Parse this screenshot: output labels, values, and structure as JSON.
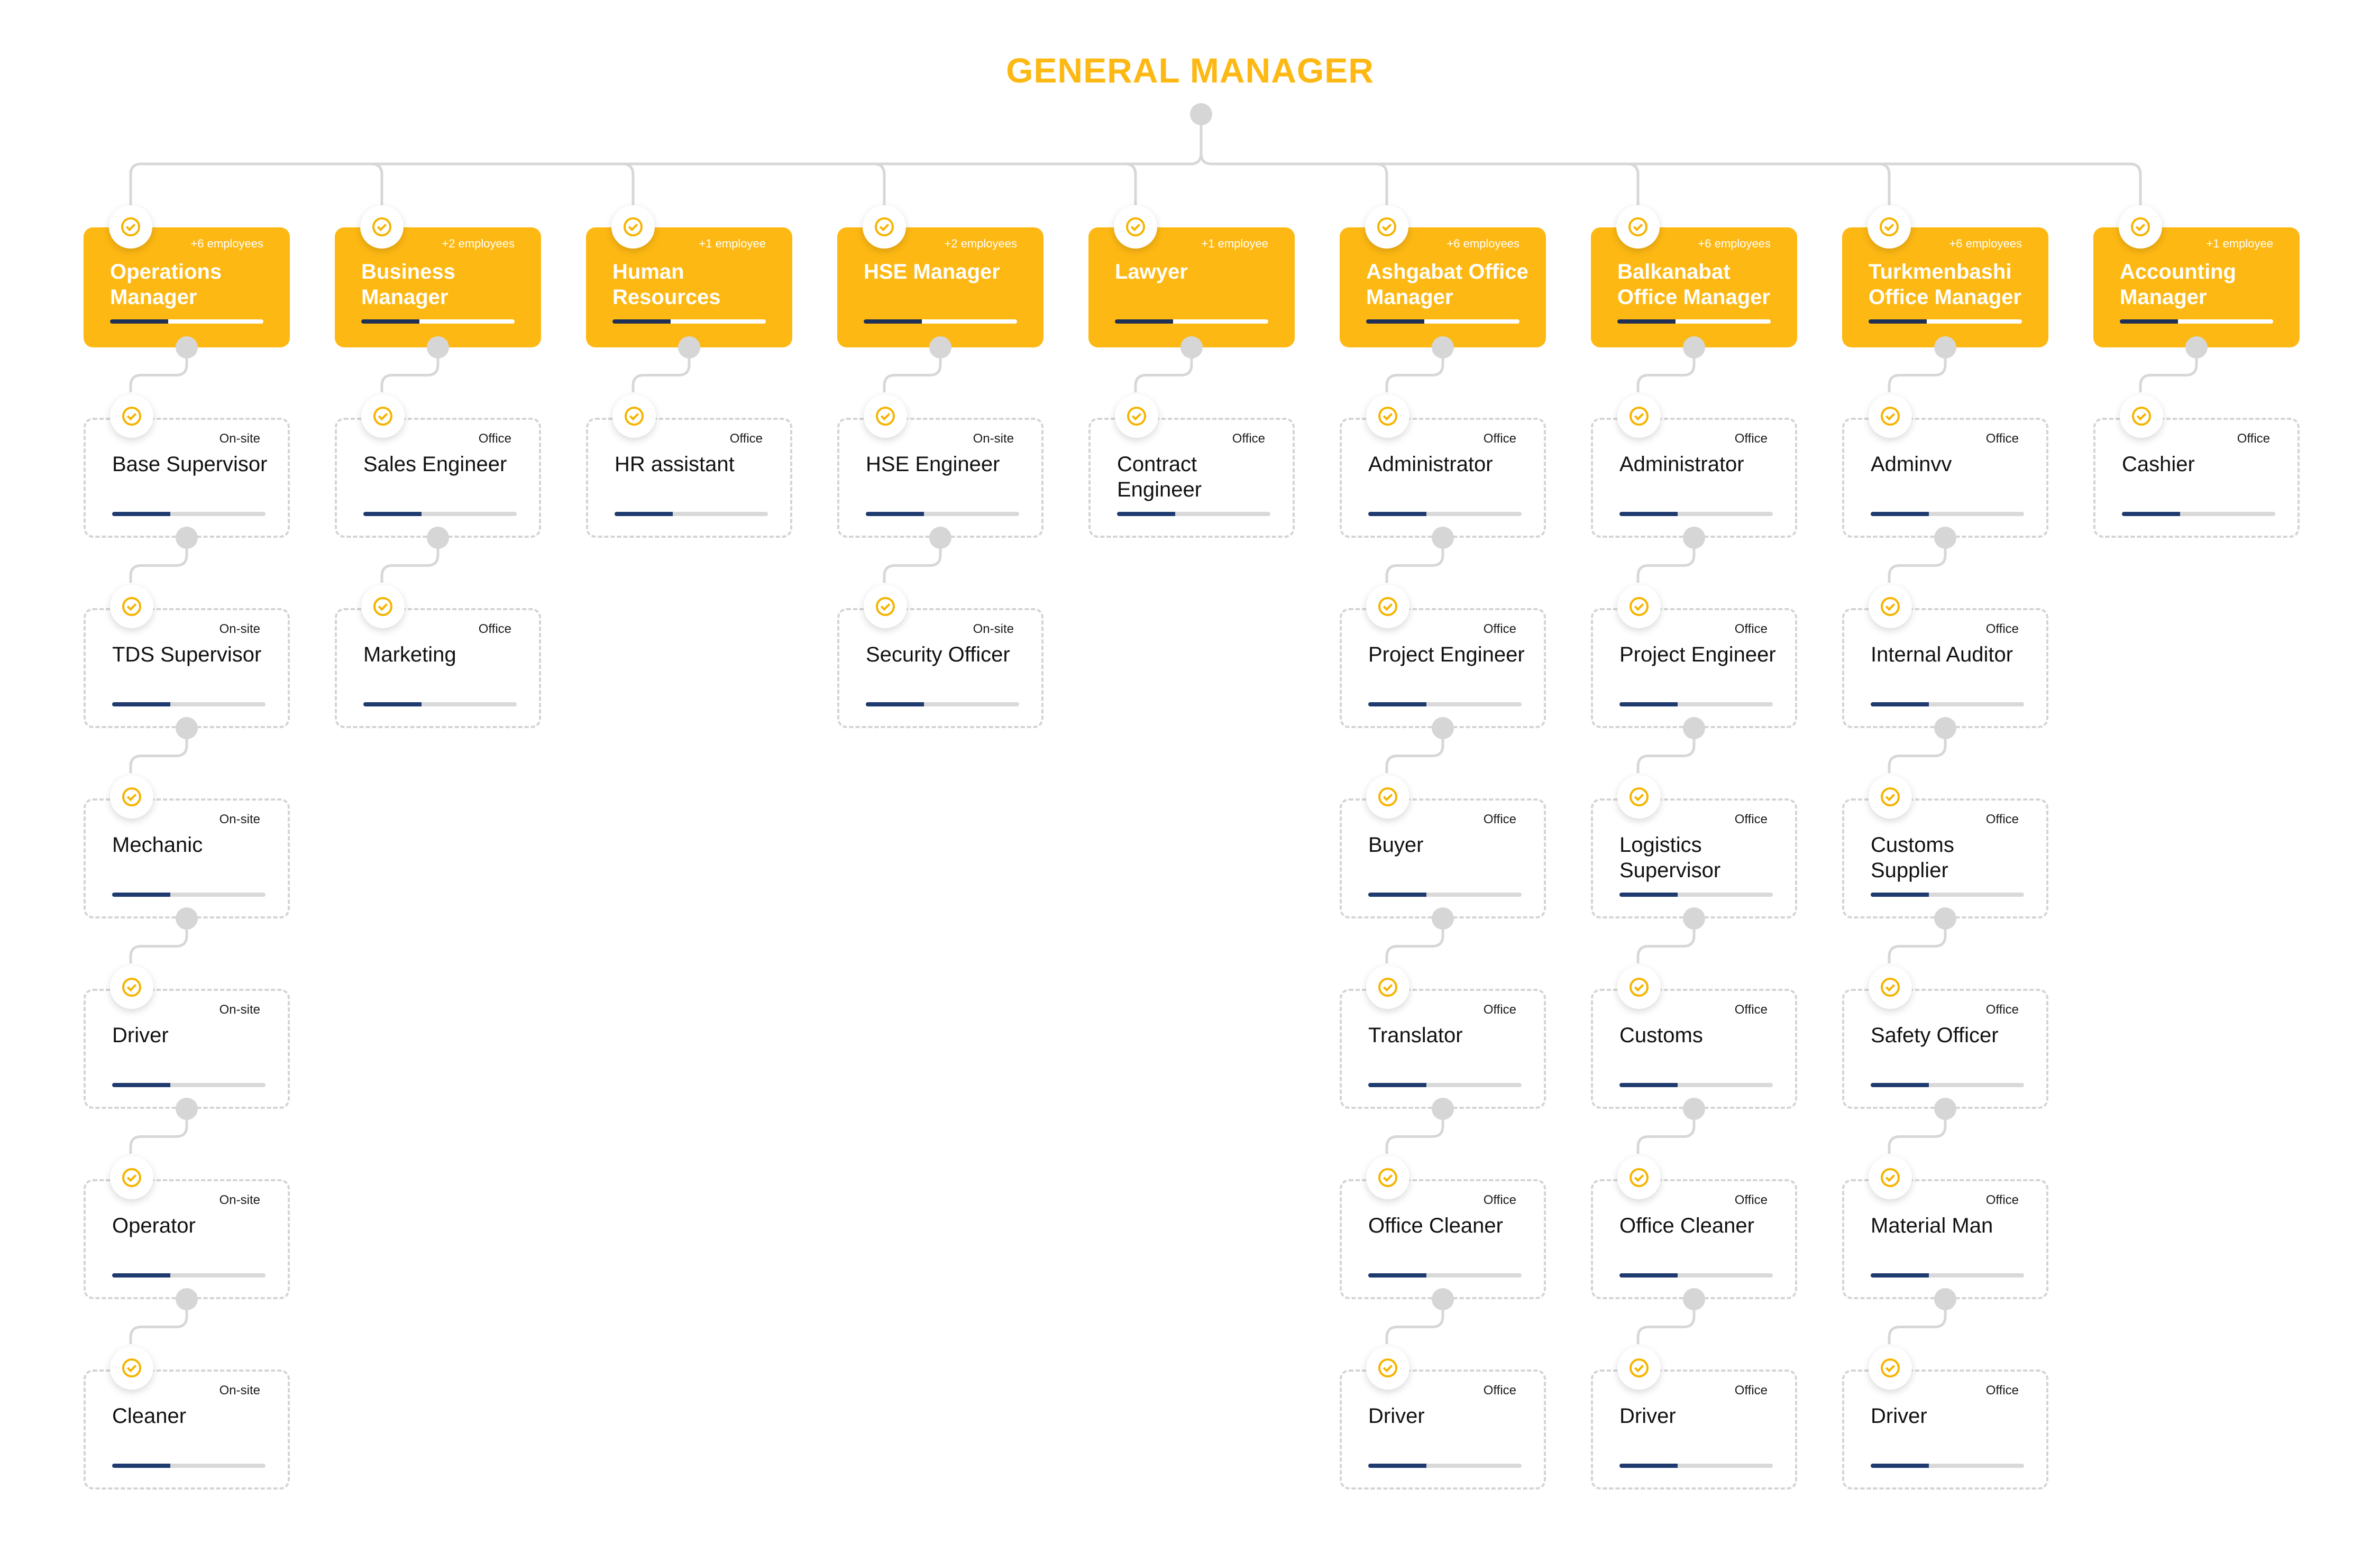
{
  "title": "GENERAL MANAGER",
  "columns": [
    {
      "manager": {
        "label": "Operations Manager",
        "count": "+6 employees",
        "progress": 0.38
      },
      "staff": [
        {
          "label": "Base Supervisor",
          "tag": "On-site",
          "progress": 0.38
        },
        {
          "label": "TDS Supervisor",
          "tag": "On-site",
          "progress": 0.38
        },
        {
          "label": "Mechanic",
          "tag": "On-site",
          "progress": 0.38
        },
        {
          "label": "Driver",
          "tag": "On-site",
          "progress": 0.38
        },
        {
          "label": "Operator",
          "tag": "On-site",
          "progress": 0.38
        },
        {
          "label": "Cleaner",
          "tag": "On-site",
          "progress": 0.38
        }
      ]
    },
    {
      "manager": {
        "label": "Business Manager",
        "count": "+2 employees",
        "progress": 0.38
      },
      "staff": [
        {
          "label": "Sales Engineer",
          "tag": "Office",
          "progress": 0.38
        },
        {
          "label": "Marketing",
          "tag": "Office",
          "progress": 0.38
        }
      ]
    },
    {
      "manager": {
        "label": "Human Resources",
        "count": "+1 employee",
        "progress": 0.38
      },
      "staff": [
        {
          "label": "HR assistant",
          "tag": "Office",
          "progress": 0.38
        }
      ]
    },
    {
      "manager": {
        "label": "HSE Manager",
        "count": "+2 employees",
        "progress": 0.38
      },
      "staff": [
        {
          "label": "HSE Engineer",
          "tag": "On-site",
          "progress": 0.38
        },
        {
          "label": "Security Officer",
          "tag": "On-site",
          "progress": 0.38
        }
      ]
    },
    {
      "manager": {
        "label": "Lawyer",
        "count": "+1 employee",
        "progress": 0.38
      },
      "staff": [
        {
          "label": "Contract Engineer",
          "tag": "Office",
          "progress": 0.38
        }
      ]
    },
    {
      "manager": {
        "label": "Ashgabat Office Manager",
        "count": "+6 employees",
        "progress": 0.38
      },
      "staff": [
        {
          "label": "Administrator",
          "tag": "Office",
          "progress": 0.38
        },
        {
          "label": "Project Engineer",
          "tag": "Office",
          "progress": 0.38
        },
        {
          "label": "Buyer",
          "tag": "Office",
          "progress": 0.38
        },
        {
          "label": "Translator",
          "tag": "Office",
          "progress": 0.38
        },
        {
          "label": "Office Cleaner",
          "tag": "Office",
          "progress": 0.38
        },
        {
          "label": "Driver",
          "tag": "Office",
          "progress": 0.38
        }
      ]
    },
    {
      "manager": {
        "label": "Balkanabat Office Manager",
        "count": "+6 employees",
        "progress": 0.38
      },
      "staff": [
        {
          "label": "Administrator",
          "tag": "Office",
          "progress": 0.38
        },
        {
          "label": "Project Engineer",
          "tag": "Office",
          "progress": 0.38
        },
        {
          "label": "Logistics Supervisor",
          "tag": "Office",
          "progress": 0.38
        },
        {
          "label": "Customs",
          "tag": "Office",
          "progress": 0.38
        },
        {
          "label": "Office Cleaner",
          "tag": "Office",
          "progress": 0.38
        },
        {
          "label": "Driver",
          "tag": "Office",
          "progress": 0.38
        }
      ]
    },
    {
      "manager": {
        "label": "Turkmenbashi Office Manager",
        "count": "+6 employees",
        "progress": 0.38
      },
      "staff": [
        {
          "label": "Adminvv",
          "tag": "Office",
          "progress": 0.38
        },
        {
          "label": "Internal Auditor",
          "tag": "Office",
          "progress": 0.38
        },
        {
          "label": "Customs Supplier",
          "tag": "Office",
          "progress": 0.38
        },
        {
          "label": "Safety Officer",
          "tag": "Office",
          "progress": 0.38
        },
        {
          "label": "Material Man",
          "tag": "Office",
          "progress": 0.38
        },
        {
          "label": "Driver",
          "tag": "Office",
          "progress": 0.38
        }
      ]
    },
    {
      "manager": {
        "label": "Accounting Manager",
        "count": "+1 employee",
        "progress": 0.38
      },
      "staff": [
        {
          "label": "Cashier",
          "tag": "Office",
          "progress": 0.38
        }
      ]
    }
  ]
}
